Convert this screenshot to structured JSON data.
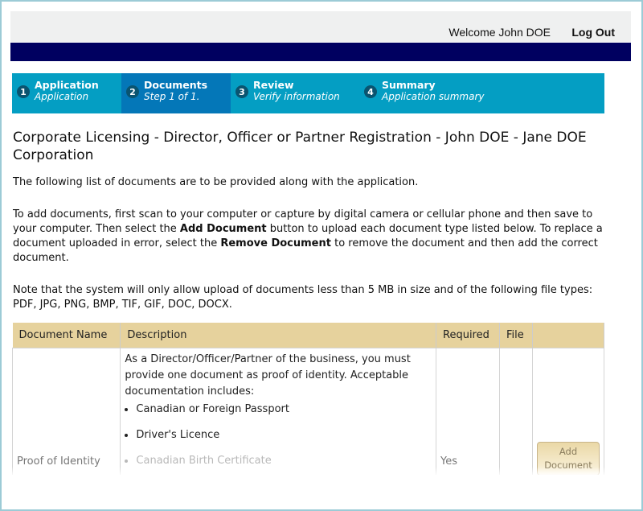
{
  "header": {
    "welcome_text": "Welcome John DOE",
    "logout_label": "Log Out"
  },
  "steps": [
    {
      "number": "1",
      "title": "Application",
      "subtitle": "Application",
      "active": false
    },
    {
      "number": "2",
      "title": "Documents",
      "subtitle": "Step 1 of 1.",
      "active": true
    },
    {
      "number": "3",
      "title": "Review",
      "subtitle": "Verify information",
      "active": false
    },
    {
      "number": "4",
      "title": "Summary",
      "subtitle": "Application summary",
      "active": false
    }
  ],
  "page": {
    "title": "Corporate Licensing - Director, Officer or Partner Registration - John DOE - Jane DOE Corporation",
    "intro": "The following list of documents are to be provided along with the application.",
    "instructions": {
      "part1": "To add documents, first scan to your computer or capture by digital camera or cellular phone and then save to your computer. Then select the ",
      "bold1": "Add Document",
      "part2": " button to upload each document type listed below. To replace a document uploaded in error, select the ",
      "bold2": "Remove Document",
      "part3": " to remove the document and then add the correct document."
    },
    "note": "Note that the system will only allow upload of documents less than 5 MB in size and of the following file types: PDF, JPG, PNG, BMP, TIF, GIF, DOC, DOCX."
  },
  "table": {
    "headers": [
      "Document Name",
      "Description",
      "Required",
      "File",
      ""
    ],
    "rows": [
      {
        "name": "Proof of Identity",
        "description": "As a Director/Officer/Partner of the business, you must provide one document as proof of identity. Acceptable documentation includes:",
        "items": [
          "Canadian or Foreign Passport",
          "Driver's Licence",
          "Canadian Birth Certificate"
        ],
        "required": "Yes",
        "file": "",
        "action_label": "Add Document"
      }
    ]
  },
  "colors": {
    "navy_bar": "#000060",
    "steps_bg": "#049ec3",
    "step_active_bg": "#0477b8",
    "table_header_bg": "#e6d29d"
  }
}
